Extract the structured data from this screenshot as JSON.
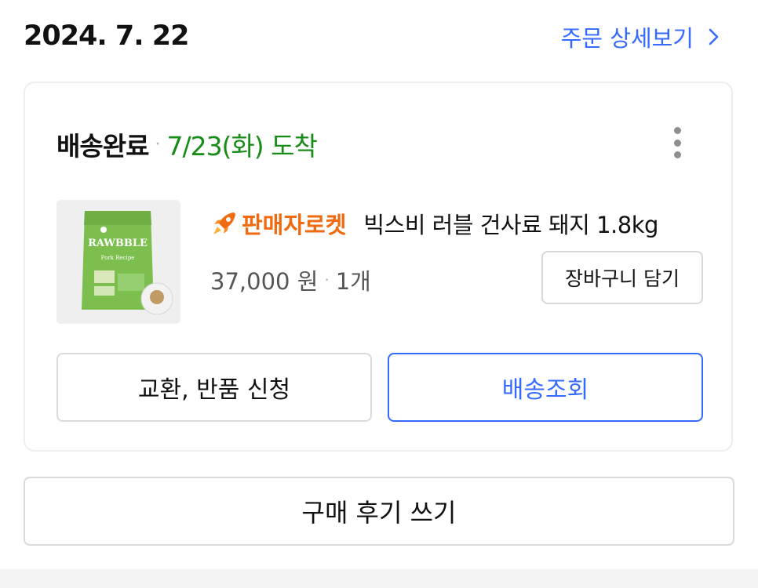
{
  "order": {
    "date": "2024. 7. 22",
    "detail_link": "주문 상세보기"
  },
  "shipment": {
    "status": "배송완료",
    "arrival": "7/23(화) 도착"
  },
  "product": {
    "badge": "판매자로켓",
    "name": "빅스비 러블 건사료 돼지 1.8kg",
    "price": "37,000 원",
    "quantity": "1개",
    "image_brand": "RAWBBLE",
    "image_subtitle": "Pork Recipe",
    "cart_button": "장바구니 담기"
  },
  "actions": {
    "exchange_return": "교환, 반품 신청",
    "track_delivery": "배송조회",
    "write_review": "구매 후기 쓰기"
  },
  "colors": {
    "link_blue": "#346aff",
    "arrival_green": "#178c17",
    "rocket_orange": "#f06a0f"
  }
}
